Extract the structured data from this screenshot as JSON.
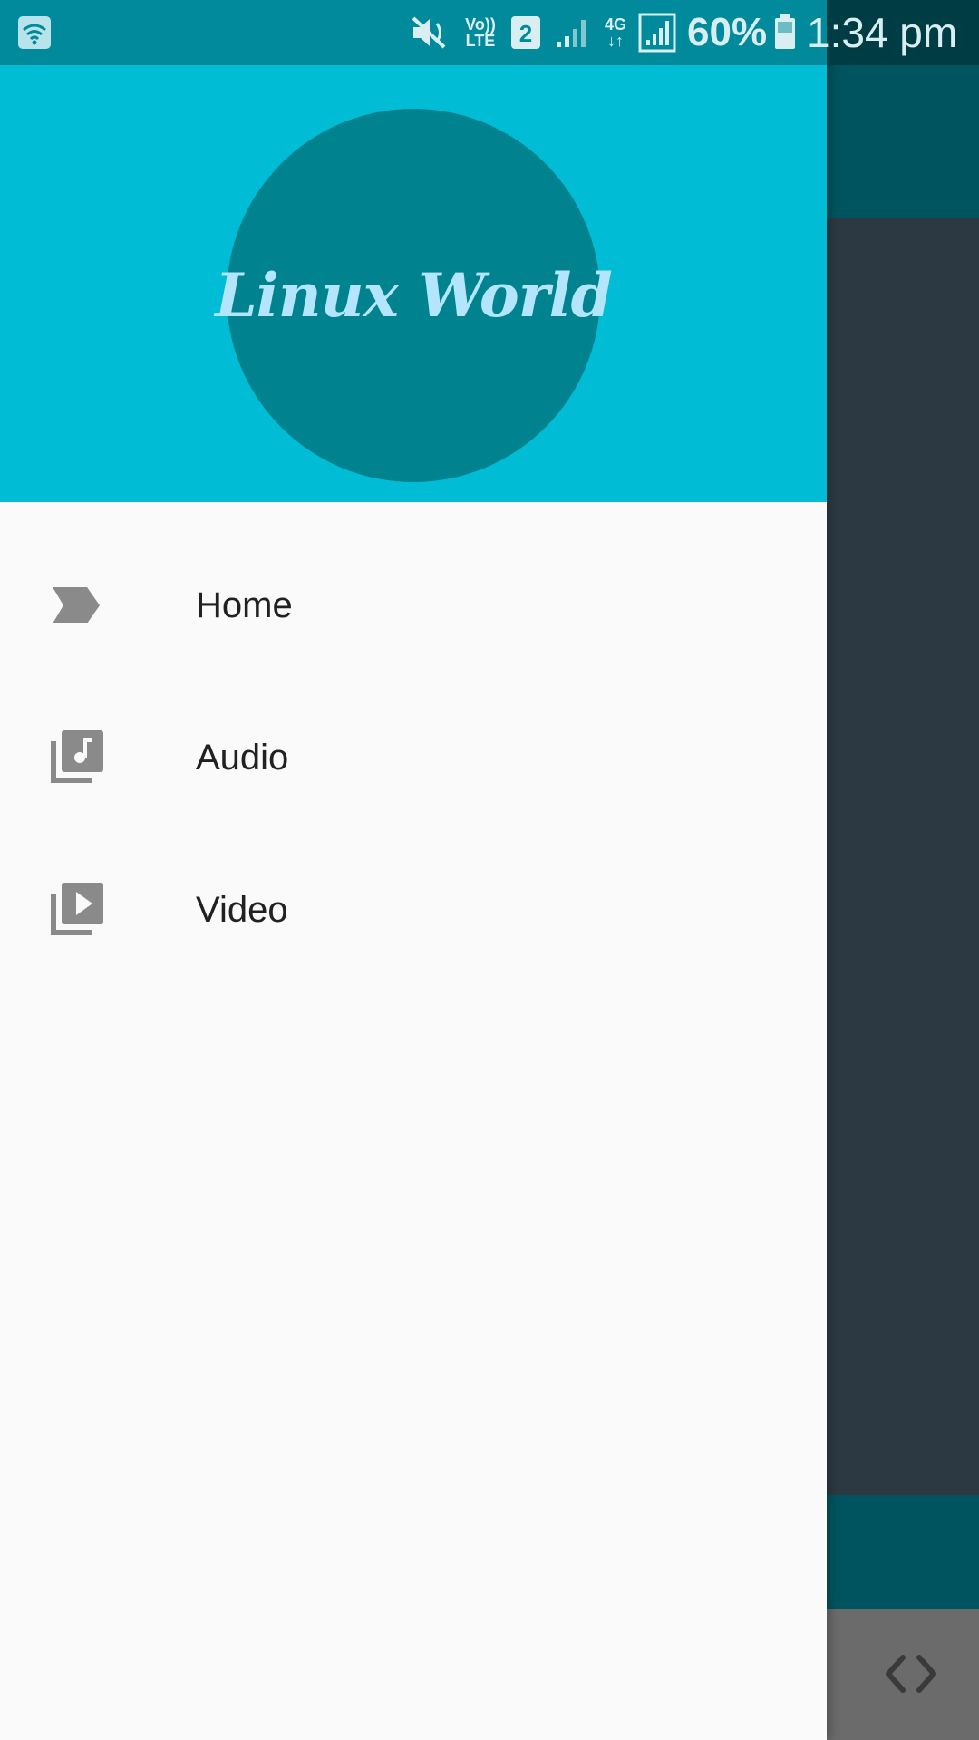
{
  "status_bar": {
    "volte": [
      "Vo))",
      "LTE"
    ],
    "sim_slot": "2",
    "network": [
      "4G",
      "↓↑"
    ],
    "battery_percent": "60%",
    "time": "1:34 pm"
  },
  "drawer": {
    "logo_text": "Linux World",
    "header_color": "#00bcd4",
    "items": [
      {
        "label": "Home",
        "icon": "label-arrow-icon"
      },
      {
        "label": "Audio",
        "icon": "audio-library-icon"
      },
      {
        "label": "Video",
        "icon": "video-library-icon"
      }
    ]
  },
  "background": {
    "bottom_icon": "code-icon"
  }
}
